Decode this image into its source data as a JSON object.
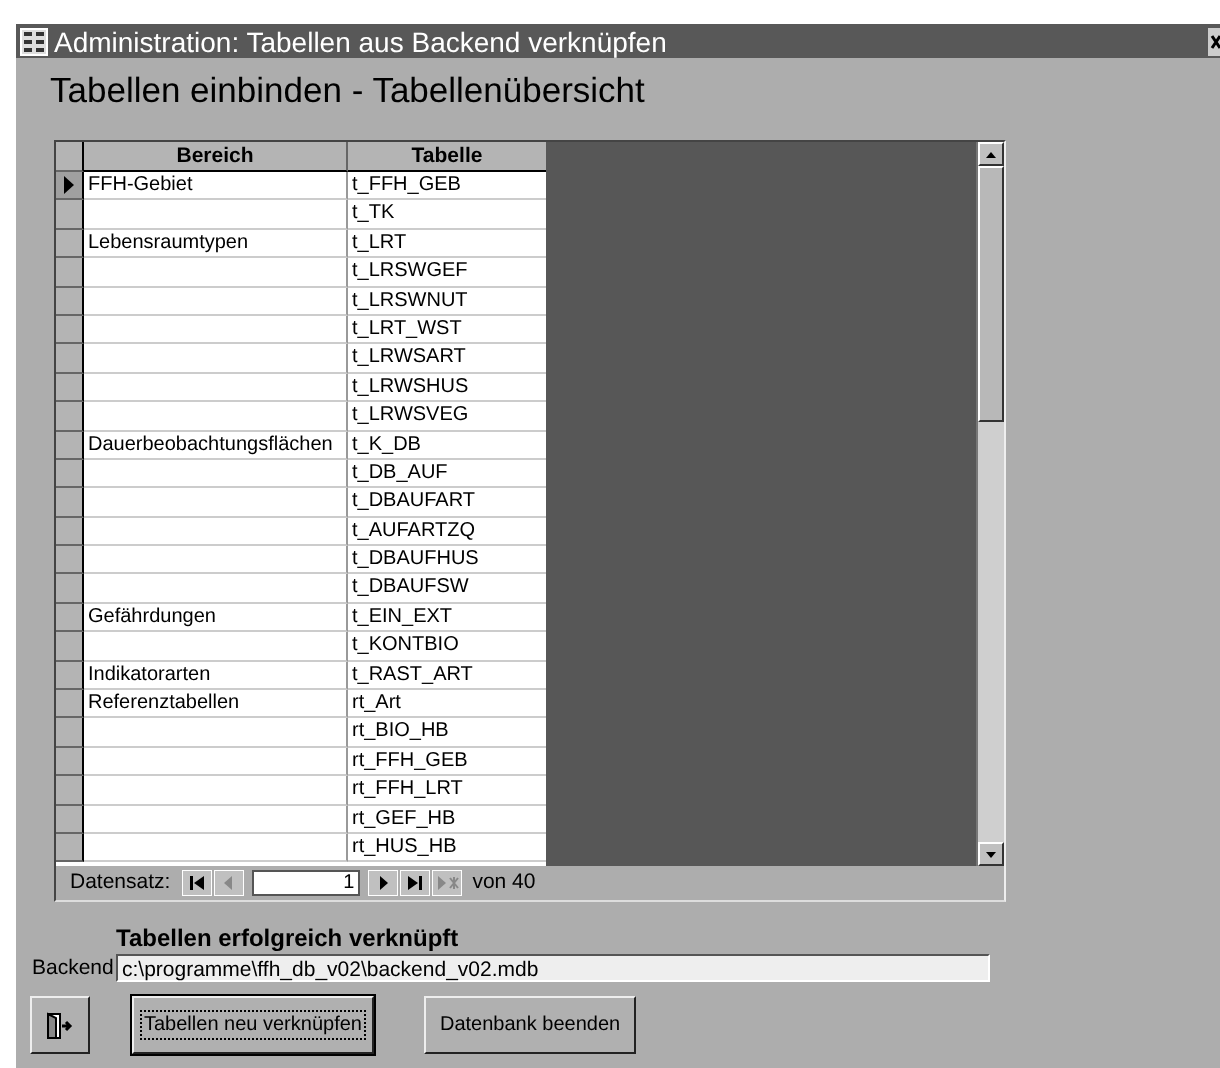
{
  "window": {
    "title": "Administration: Tabellen aus Backend verknüpfen"
  },
  "heading": "Tabellen einbinden - Tabellenübersicht",
  "table": {
    "columns": [
      "Bereich",
      "Tabelle"
    ],
    "rows": [
      {
        "bereich": "FFH-Gebiet",
        "tabelle": "t_FFH_GEB",
        "selected": true
      },
      {
        "bereich": "",
        "tabelle": "t_TK",
        "selected": false
      },
      {
        "bereich": "Lebensraumtypen",
        "tabelle": "t_LRT",
        "selected": false
      },
      {
        "bereich": "",
        "tabelle": "t_LRSWGEF",
        "selected": false
      },
      {
        "bereich": "",
        "tabelle": "t_LRSWNUT",
        "selected": false
      },
      {
        "bereich": "",
        "tabelle": "t_LRT_WST",
        "selected": false
      },
      {
        "bereich": "",
        "tabelle": "t_LRWSART",
        "selected": false
      },
      {
        "bereich": "",
        "tabelle": "t_LRWSHUS",
        "selected": false
      },
      {
        "bereich": "",
        "tabelle": "t_LRWSVEG",
        "selected": false
      },
      {
        "bereich": "Dauerbeobachtungsflächen",
        "tabelle": "t_K_DB",
        "selected": false
      },
      {
        "bereich": "",
        "tabelle": "t_DB_AUF",
        "selected": false
      },
      {
        "bereich": "",
        "tabelle": "t_DBAUFART",
        "selected": false
      },
      {
        "bereich": "",
        "tabelle": "t_AUFARTZQ",
        "selected": false
      },
      {
        "bereich": "",
        "tabelle": "t_DBAUFHUS",
        "selected": false
      },
      {
        "bereich": "",
        "tabelle": "t_DBAUFSW",
        "selected": false
      },
      {
        "bereich": "Gefährdungen",
        "tabelle": "t_EIN_EXT",
        "selected": false
      },
      {
        "bereich": "",
        "tabelle": "t_KONTBIO",
        "selected": false
      },
      {
        "bereich": "Indikatorarten",
        "tabelle": "t_RAST_ART",
        "selected": false
      },
      {
        "bereich": "Referenztabellen",
        "tabelle": "rt_Art",
        "selected": false
      },
      {
        "bereich": "",
        "tabelle": "rt_BIO_HB",
        "selected": false
      },
      {
        "bereich": "",
        "tabelle": "rt_FFH_GEB",
        "selected": false
      },
      {
        "bereich": "",
        "tabelle": "rt_FFH_LRT",
        "selected": false
      },
      {
        "bereich": "",
        "tabelle": "rt_GEF_HB",
        "selected": false
      },
      {
        "bereich": "",
        "tabelle": "rt_HUS_HB",
        "selected": false
      }
    ]
  },
  "navigation": {
    "label": "Datensatz:",
    "record": "1",
    "total": "von 40",
    "buttons": [
      {
        "kind": "first",
        "disabled": false
      },
      {
        "kind": "prev",
        "disabled": true
      },
      {
        "kind": "next",
        "disabled": false
      },
      {
        "kind": "last",
        "disabled": false
      },
      {
        "kind": "new",
        "disabled": true
      }
    ]
  },
  "status": "Tabellen erfolgreich verknüpft",
  "backend": {
    "label": "Backend",
    "value": "c:\\programme\\ffh_db_v02\\backend_v02.mdb"
  },
  "buttons": [
    {
      "kind": "icon",
      "focused": false
    },
    {
      "kind": "text",
      "label": "Tabellen neu verknüpfen",
      "focused": true
    },
    {
      "kind": "text",
      "label": "Datenbank beenden",
      "focused": false
    }
  ]
}
